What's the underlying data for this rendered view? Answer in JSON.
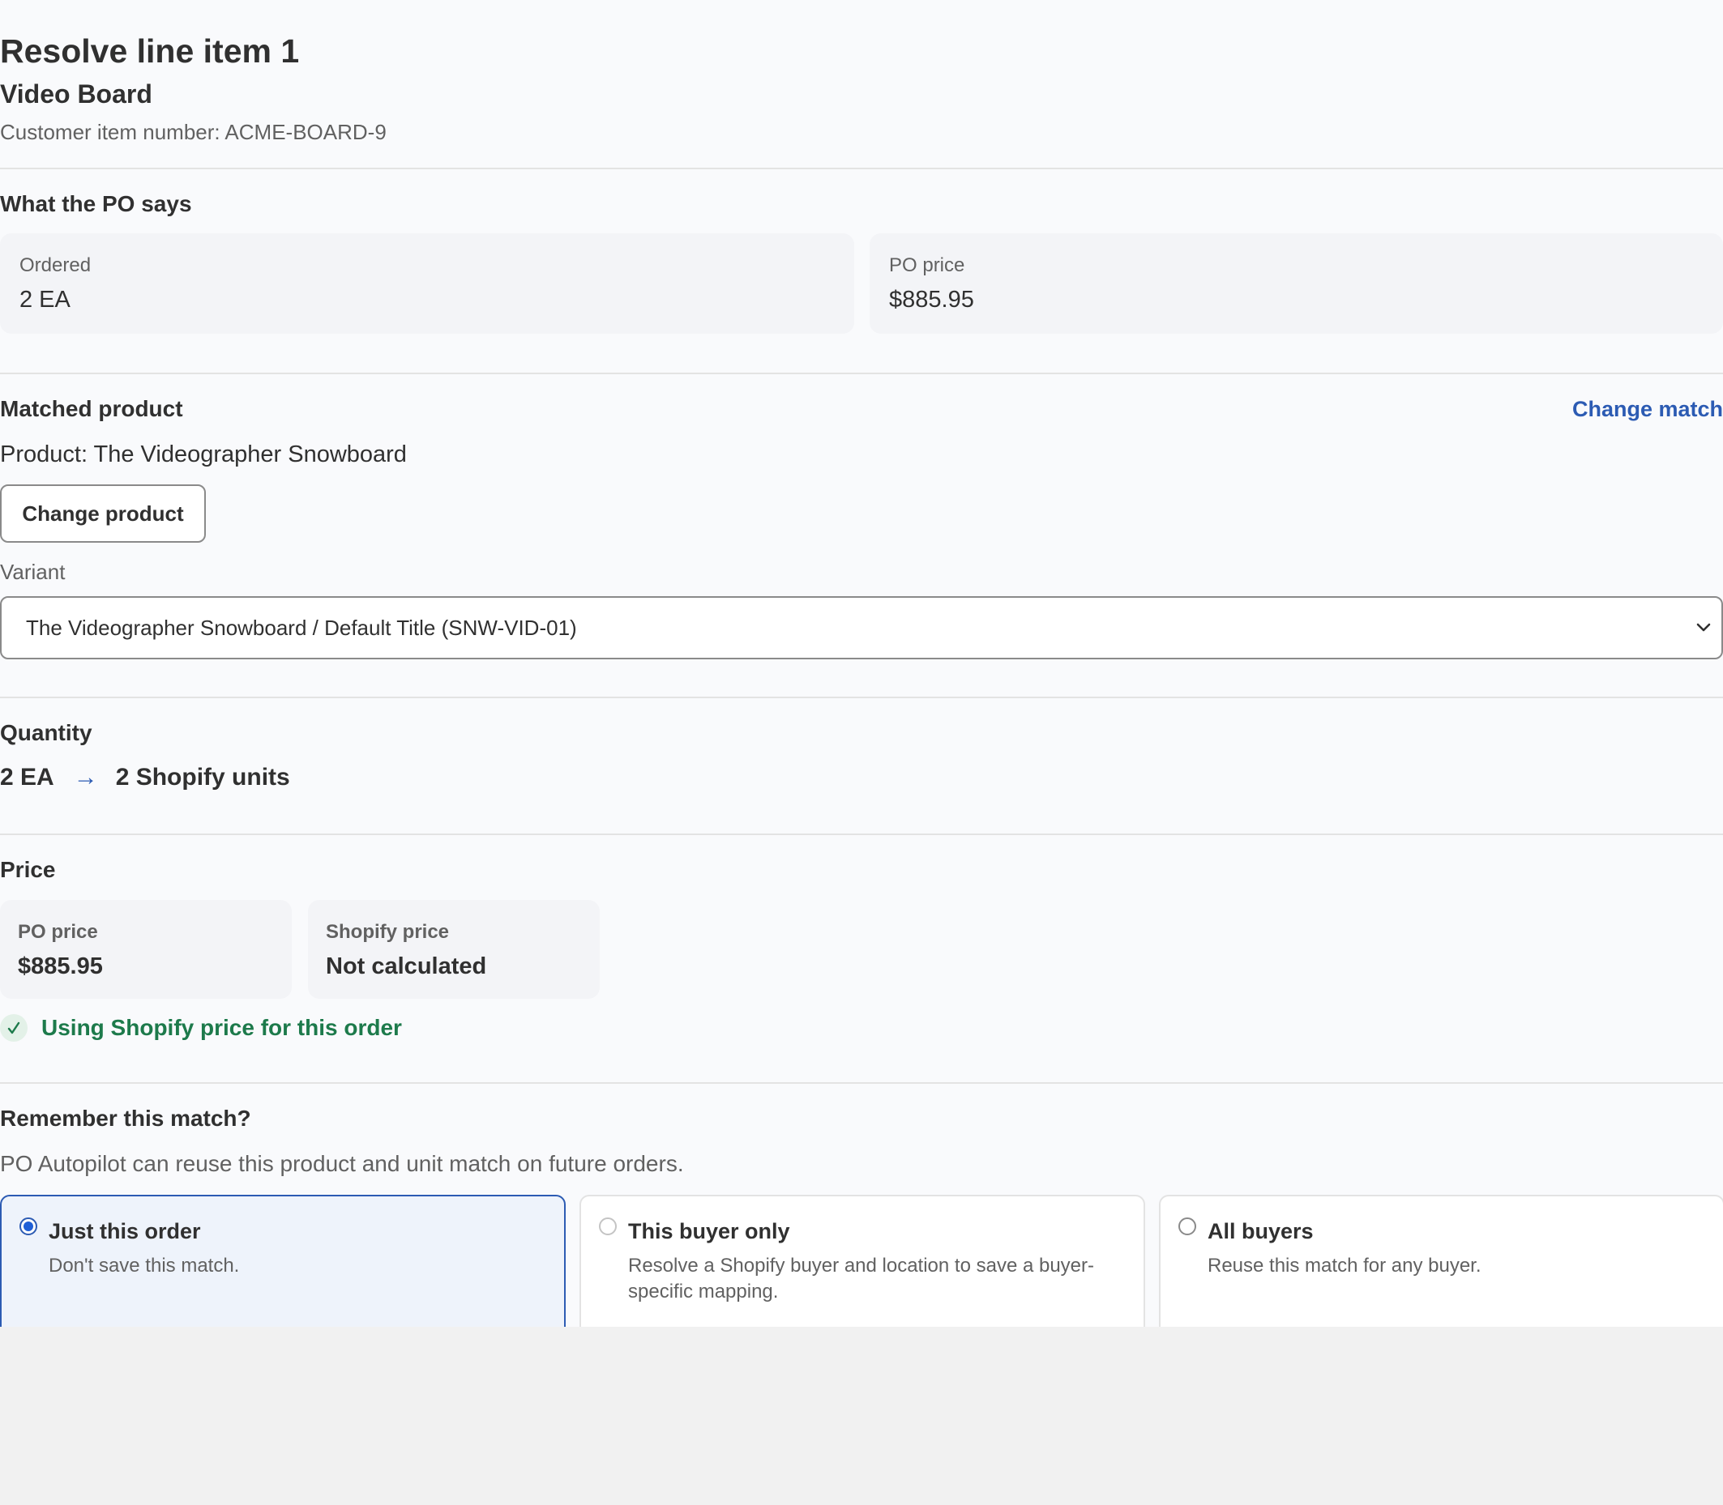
{
  "header": {
    "title": "Resolve line item 1",
    "subtitle": "Video Board",
    "customer_item": "Customer item number: ACME-BOARD-9"
  },
  "po_section": {
    "title": "What the PO says",
    "ordered_label": "Ordered",
    "ordered_value": "2 EA",
    "price_label": "PO price",
    "price_value": "$885.95"
  },
  "matched": {
    "title": "Matched product",
    "change_match": "Change match",
    "product": "Product: The Videographer Snowboard",
    "change_product": "Change product",
    "variant_label": "Variant",
    "variant_value": "The Videographer Snowboard / Default Title (SNW-VID-01)"
  },
  "quantity": {
    "title": "Quantity",
    "from": "2 EA",
    "arrow": "→",
    "to": "2 Shopify units"
  },
  "price": {
    "title": "Price",
    "po_label": "PO price",
    "po_value": "$885.95",
    "shopify_label": "Shopify price",
    "shopify_value": "Not calculated",
    "status": "Using Shopify price for this order"
  },
  "remember": {
    "title": "Remember this match?",
    "description": "PO Autopilot can reuse this product and unit match on future orders.",
    "options": [
      {
        "title": "Just this order",
        "desc": "Don't save this match.",
        "selected": true
      },
      {
        "title": "This buyer only",
        "desc": "Resolve a Shopify buyer and location to save a buyer-specific mapping.",
        "selected": false,
        "disabled": true
      },
      {
        "title": "All buyers",
        "desc": "Reuse this match for any buyer.",
        "selected": false
      }
    ]
  },
  "colors": {
    "accent": "#2c5bb3",
    "success": "#1d7a4b",
    "background": "#f9fafc"
  }
}
